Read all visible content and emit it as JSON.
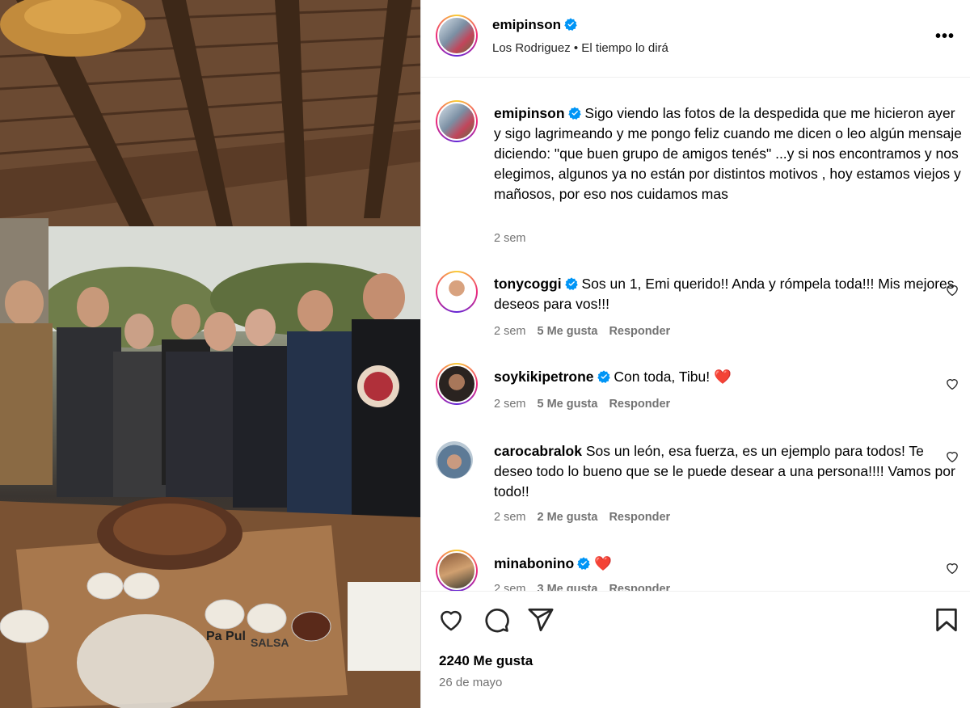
{
  "post": {
    "username": "emipinson",
    "subtitle": "Los Rodriguez • El tiempo lo dirá",
    "more_icon": "more-horizontal-icon",
    "caption": "Sigo viendo las fotos de la despedida que me hicieron ayer y sigo lagrimeando y me pongo feliz cuando me dicen o leo algún mensaje diciendo: \"que buen grupo de amigos tenés\" ...y si nos encontramos y nos elegimos, algunos ya no están por distintos motivos , hoy estamos viejos y mañosos, por eso nos cuidamos mas",
    "caption_time": "2 sem",
    "likes": "2240 Me gusta",
    "date": "26 de mayo",
    "photo_cup_text_1": "SALSA",
    "photo_cup_text_2": "Pa Pul"
  },
  "comments": [
    {
      "username": "tonycoggi",
      "text": "Sos un 1, Emi querido!! Anda y rómpela toda!!! Mis mejores deseos para vos!!!",
      "time": "2 sem",
      "likes": "5 Me gusta",
      "reply": "Responder",
      "verified": true
    },
    {
      "username": "soykikipetrone",
      "text": "Con toda, Tibu! ❤️",
      "time": "2 sem",
      "likes": "5 Me gusta",
      "reply": "Responder",
      "verified": true
    },
    {
      "username": "carocabralok",
      "text": "Sos un león, esa fuerza, es un ejemplo para todos! Te deseo todo lo bueno que se le puede desear a una persona!!!! Vamos por todo!!",
      "time": "2 sem",
      "likes": "2 Me gusta",
      "reply": "Responder",
      "verified": false
    },
    {
      "username": "minabonino",
      "text": "❤️",
      "time": "2 sem",
      "likes": "3 Me gusta",
      "reply": "Responder",
      "verified": true
    }
  ],
  "colors": {
    "verified": "#0095f6",
    "heart": "#ed1c24",
    "muted": "#737373"
  },
  "icons": [
    "verified-badge-icon",
    "heart-icon",
    "comment-icon",
    "share-icon",
    "bookmark-icon",
    "more-horizontal-icon"
  ]
}
